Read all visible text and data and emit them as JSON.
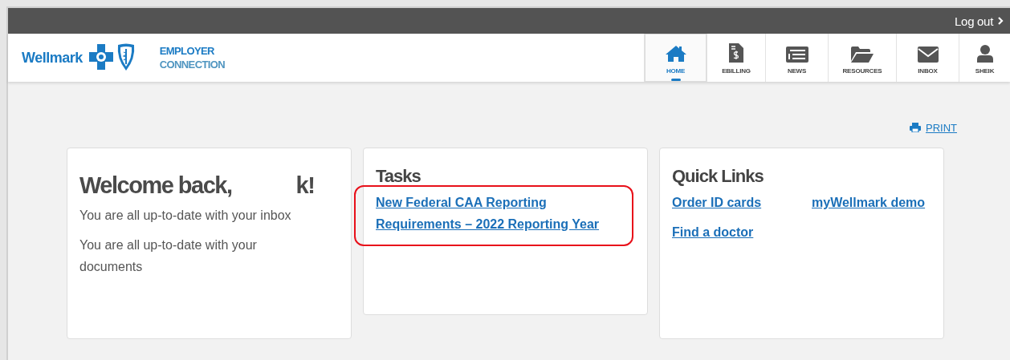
{
  "top_bar": {
    "logout": "Log out"
  },
  "header": {
    "brand": "Wellmark",
    "product_line_1": "EMPLOYER",
    "product_line_2": "CONNECTION",
    "nav": [
      {
        "label": "HOME",
        "kind": "home",
        "selected": true
      },
      {
        "label": "EBILLING",
        "kind": "bill",
        "selected": false
      },
      {
        "label": "NEWS",
        "kind": "news",
        "selected": false
      },
      {
        "label": "RESOURCES",
        "kind": "folder",
        "selected": false
      },
      {
        "label": "INBOX",
        "kind": "mail",
        "selected": false
      },
      {
        "label": "SHEIK",
        "kind": "user",
        "selected": false
      }
    ]
  },
  "print": "PRINT",
  "welcome": {
    "heading": "Welcome back,",
    "heading_end": "k!",
    "lines": [
      "You are all up-to-date with your inbox",
      "You are all up-to-date with your documents"
    ]
  },
  "tasks": {
    "title": "Tasks",
    "items": [
      {
        "label": "New Federal CAA Reporting Requirements – 2022 Reporting Year",
        "highlighted": true
      }
    ]
  },
  "quick_links": {
    "title": "Quick Links",
    "links": [
      "Order ID cards",
      "myWellmark demo",
      "Find a doctor"
    ]
  }
}
